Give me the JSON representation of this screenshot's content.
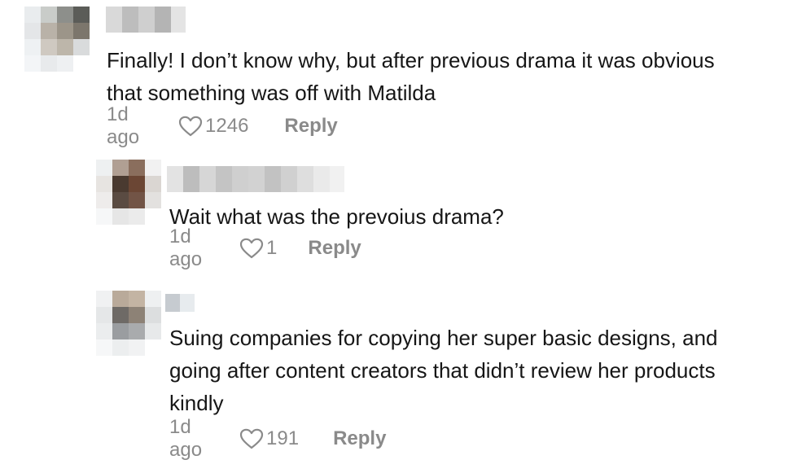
{
  "comments": [
    {
      "text_lines": [
        "Finally! I don’t know why, but after previous drama it was obvious",
        "that something was off with Matilda"
      ],
      "time": "1d ago",
      "likes": "1246",
      "reply_label": "Reply"
    },
    {
      "text_lines": [
        "Wait what was the prevoius drama?"
      ],
      "time": "1d ago",
      "likes": "1",
      "reply_label": "Reply"
    },
    {
      "text_lines": [
        "Suing companies for copying her super basic designs, and",
        "going after content creators that didn’t review her products",
        "kindly"
      ],
      "time": "1d ago",
      "likes": "191",
      "reply_label": "Reply"
    }
  ],
  "icons": {
    "like": "heart-outline-icon",
    "avatar": "blurred-avatar",
    "username": "blurred-username"
  },
  "colors": {
    "text": "#161616",
    "meta": "#8a8a8a"
  }
}
